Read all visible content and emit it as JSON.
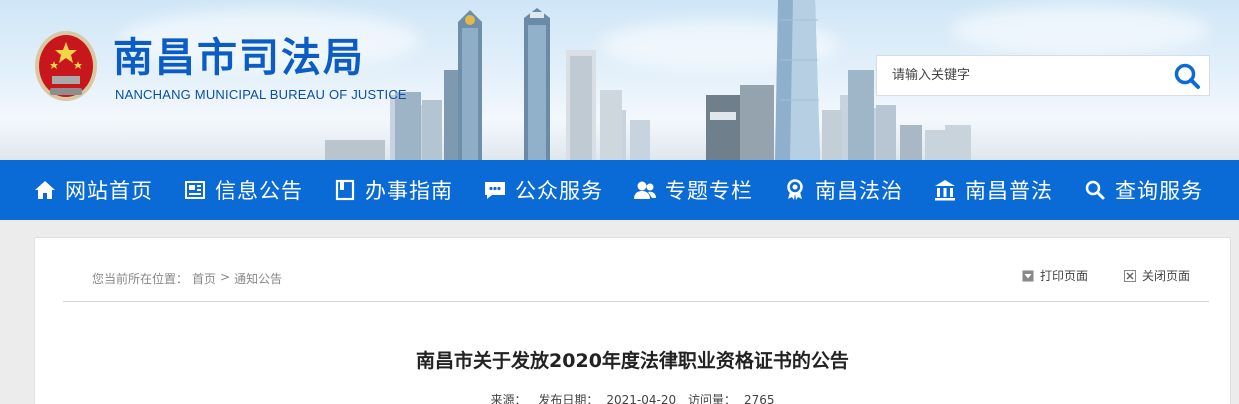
{
  "site": {
    "title": "南昌市司法局",
    "subtitle": "NANCHANG MUNICIPAL BUREAU OF JUSTICE"
  },
  "search": {
    "placeholder": "请输入关键字",
    "icon": "search-icon"
  },
  "nav": {
    "items": [
      {
        "label": "网站首页",
        "icon": "home-icon"
      },
      {
        "label": "信息公告",
        "icon": "newspaper-icon"
      },
      {
        "label": "办事指南",
        "icon": "book-icon"
      },
      {
        "label": "公众服务",
        "icon": "chat-icon"
      },
      {
        "label": "专题专栏",
        "icon": "users-icon"
      },
      {
        "label": "南昌法治",
        "icon": "ribbon-icon"
      },
      {
        "label": "南昌普法",
        "icon": "institution-icon"
      },
      {
        "label": "查询服务",
        "icon": "search-icon"
      }
    ]
  },
  "breadcrumb": {
    "prefix": "您当前所在位置：",
    "home": "首页",
    "separator": ">",
    "current": "通知公告"
  },
  "tools": {
    "print": "打印页面",
    "close": "关闭页面"
  },
  "article": {
    "title": "南昌市关于发放2020年度法律职业资格证书的公告",
    "source_label": "来源：",
    "date_label": "发布日期：",
    "date": "2021-04-20",
    "views_label": "访问量：",
    "views": "2765"
  },
  "colors": {
    "brand_blue": "#0a6ad6",
    "title_blue": "#0b5cc4",
    "emblem_red": "#c8161d"
  }
}
